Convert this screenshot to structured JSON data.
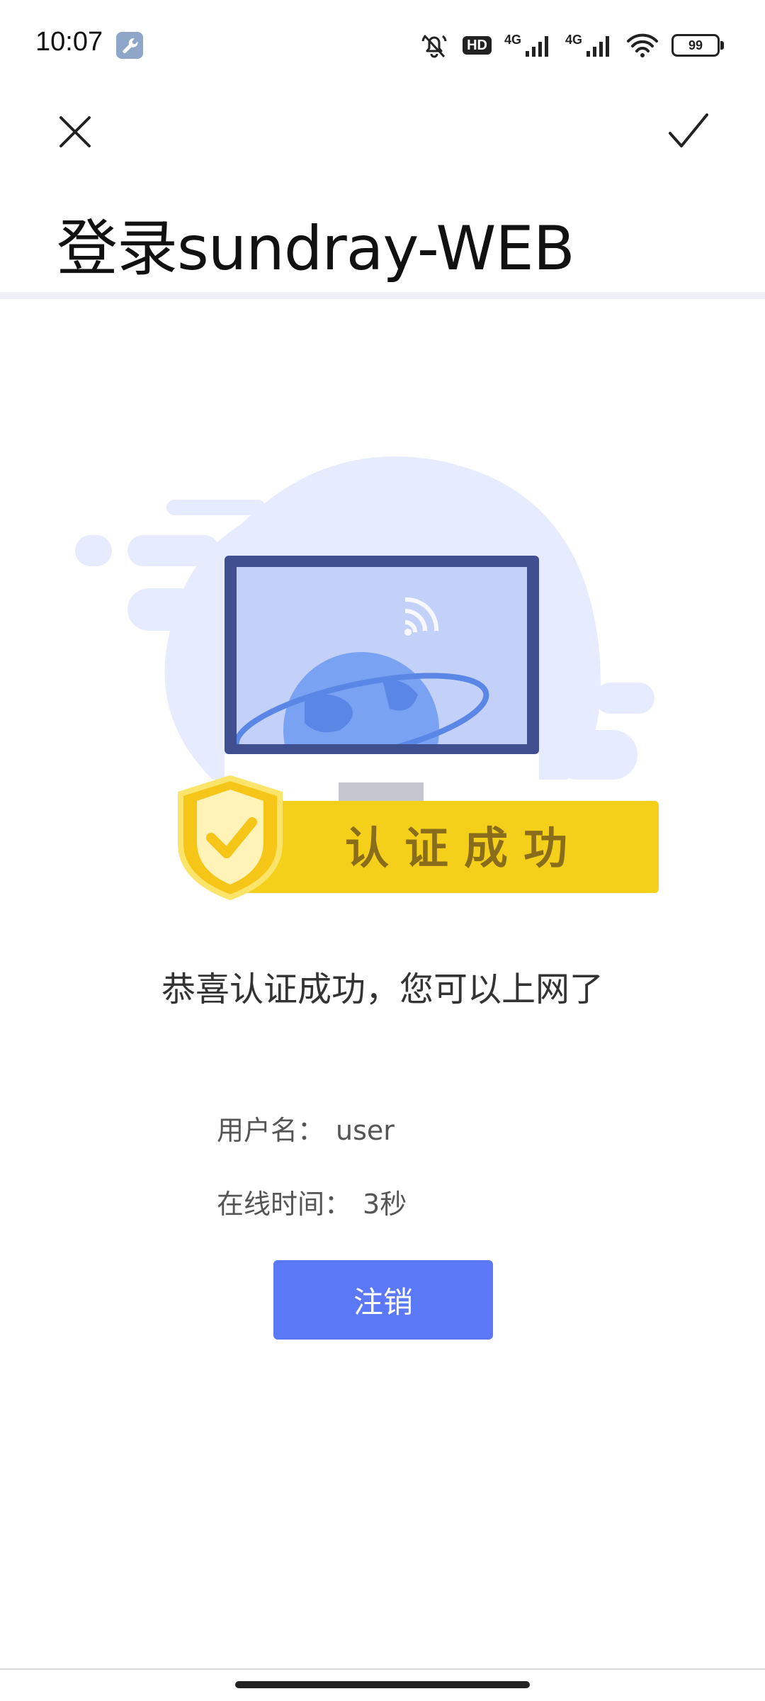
{
  "status_bar": {
    "time": "10:07",
    "hd_label": "HD",
    "network_1": "4G",
    "network_2": "4G",
    "battery": "99"
  },
  "toolbar": {
    "close_icon": "close-icon",
    "confirm_icon": "check-icon"
  },
  "page": {
    "title": "登录sundray-WEB"
  },
  "illustration": {
    "banner_text": "认证成功",
    "colors": {
      "banner": "#f5d01a",
      "shield": "#f5c518",
      "monitor_frame": "#3f4f8f",
      "screen": "#c3d0f7",
      "globe": "#7aa2f3",
      "blob": "#e6ecfd"
    }
  },
  "main": {
    "success_message": "恭喜认证成功，您可以上网了",
    "username_label": "用户名：",
    "username_value": "user",
    "online_time_label": "在线时间：",
    "online_time_value": "3秒",
    "logout_label": "注销",
    "accent_color": "#5b79f6"
  }
}
